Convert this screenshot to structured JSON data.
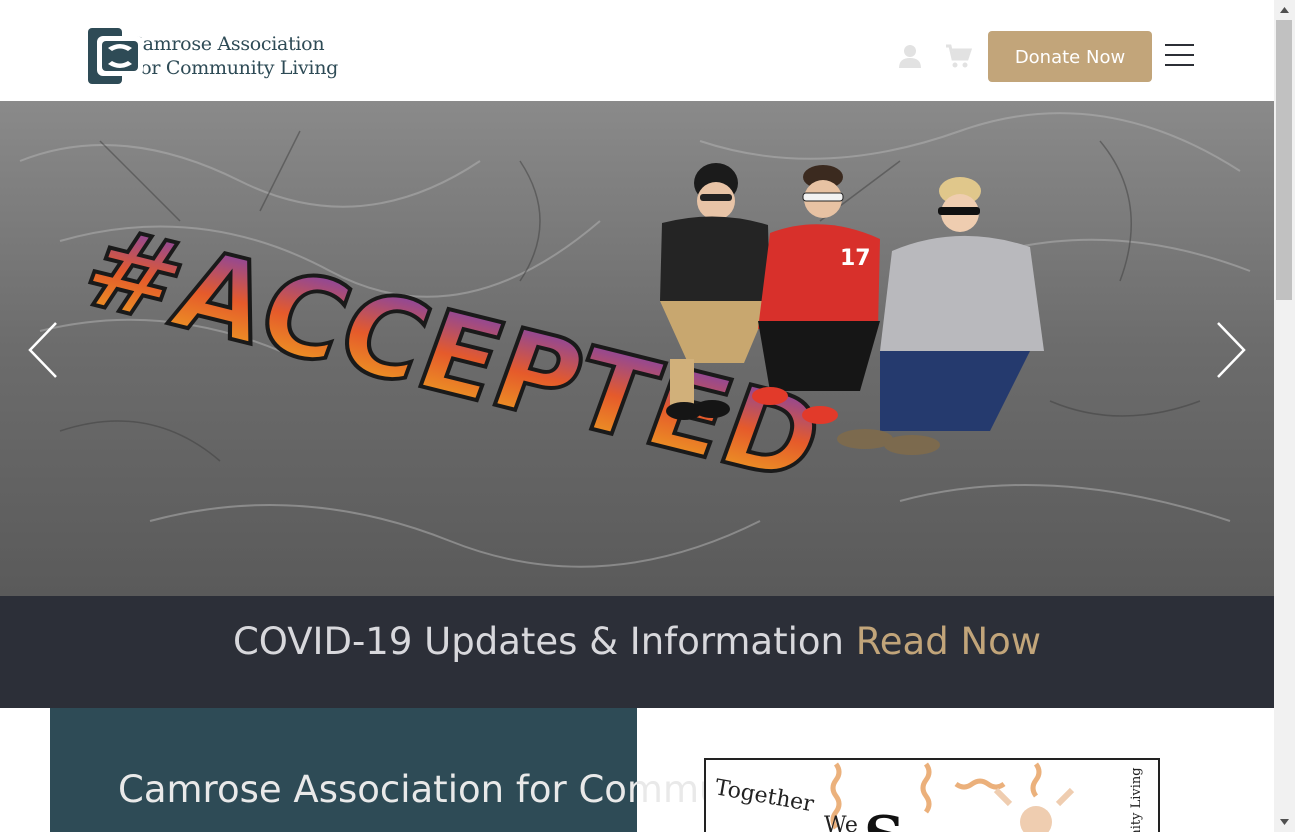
{
  "header": {
    "logo_line1": "Camrose Association",
    "logo_line2": "For Community Living",
    "account_icon": "user-icon",
    "cart_icon": "cart-icon",
    "donate_label": "Donate Now",
    "menu_icon": "hamburger-menu-icon"
  },
  "hero": {
    "prev_icon": "chevron-left-icon",
    "next_icon": "chevron-right-icon",
    "graffiti_text": "#ACCEPTED"
  },
  "banner": {
    "text": "COVID-19 Updates & Information",
    "link": "Read Now"
  },
  "about": {
    "title": "Camrose Association for Community Living"
  },
  "promo": {
    "text_together": "Together",
    "text_we": "We",
    "text_side": "unity Living"
  },
  "colors": {
    "accent": "#c2a57a",
    "dark_band": "#2c2f38",
    "teal": "#2e4b56"
  }
}
